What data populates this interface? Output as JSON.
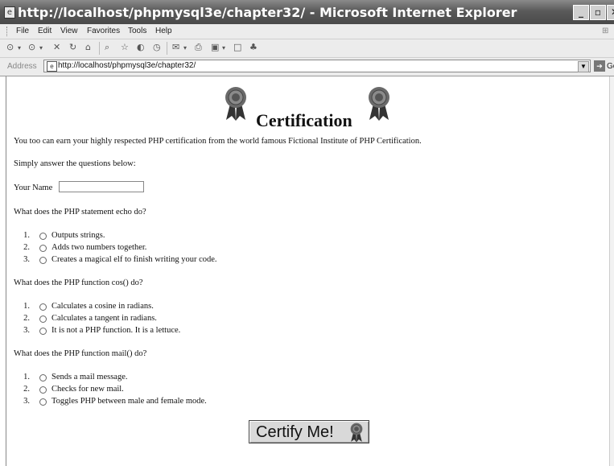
{
  "window": {
    "title": "http://localhost/phpmysql3e/chapter32/ - Microsoft Internet Explorer"
  },
  "menu": [
    "File",
    "Edit",
    "View",
    "Favorites",
    "Tools",
    "Help"
  ],
  "address": {
    "label": "Address",
    "url": "http://localhost/phpmysql3e/chapter32/",
    "go_label": "Go"
  },
  "page": {
    "heading": "Certification",
    "intro": "You too can earn your highly respected PHP certification from the world famous Fictional Institute of PHP Certification.",
    "instruction": "Simply answer the questions below:",
    "name_label": "Your Name",
    "name_value": "",
    "questions": [
      {
        "text": "What does the PHP statement echo do?",
        "options": [
          "Outputs strings.",
          "Adds two numbers together.",
          "Creates a magical elf to finish writing your code."
        ]
      },
      {
        "text": "What does the PHP function cos() do?",
        "options": [
          "Calculates a cosine in radians.",
          "Calculates a tangent in radians.",
          "It is not a PHP function. It is a lettuce."
        ]
      },
      {
        "text": "What does the PHP function mail() do?",
        "options": [
          "Sends a mail message.",
          "Checks for new mail.",
          "Toggles PHP between male and female mode."
        ]
      }
    ],
    "option_numbers": [
      "1.",
      "2.",
      "3."
    ],
    "submit_label": "Certify Me!"
  }
}
